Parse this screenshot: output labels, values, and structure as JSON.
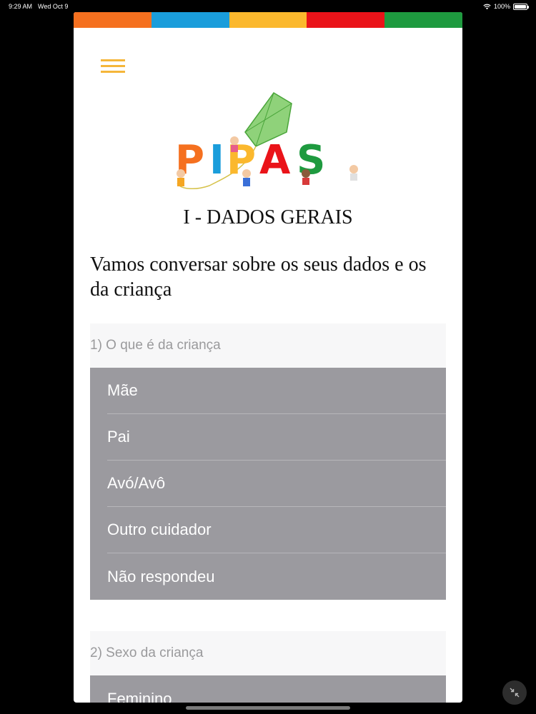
{
  "status_bar": {
    "time": "9:29 AM",
    "date": "Wed Oct 9",
    "battery": "100%",
    "battery_level": 1.0
  },
  "colors": {
    "stripes": [
      "#f5701f",
      "#1a9ddb",
      "#fbb82d",
      "#ea1319",
      "#1e9a3f"
    ],
    "menu_icon": "#f5b63a",
    "option_background": "#9b9a9f",
    "question_header_background": "#f7f7f8"
  },
  "logo": {
    "text": "PIPAS"
  },
  "section_title": "I - DADOS GERAIS",
  "intro_text": "Vamos conversar sobre os seus dados e os da criança",
  "questions": [
    {
      "label": "1) O que é da criança",
      "options": [
        "Mãe",
        "Pai",
        "Avó/Avô",
        "Outro cuidador",
        "Não respondeu"
      ]
    },
    {
      "label": "2) Sexo da criança",
      "options": [
        "Feminino"
      ]
    }
  ],
  "icons": {
    "menu": "hamburger-menu-icon",
    "wifi": "wifi-icon",
    "battery": "battery-icon",
    "minimize": "minimize-arrows-icon"
  }
}
